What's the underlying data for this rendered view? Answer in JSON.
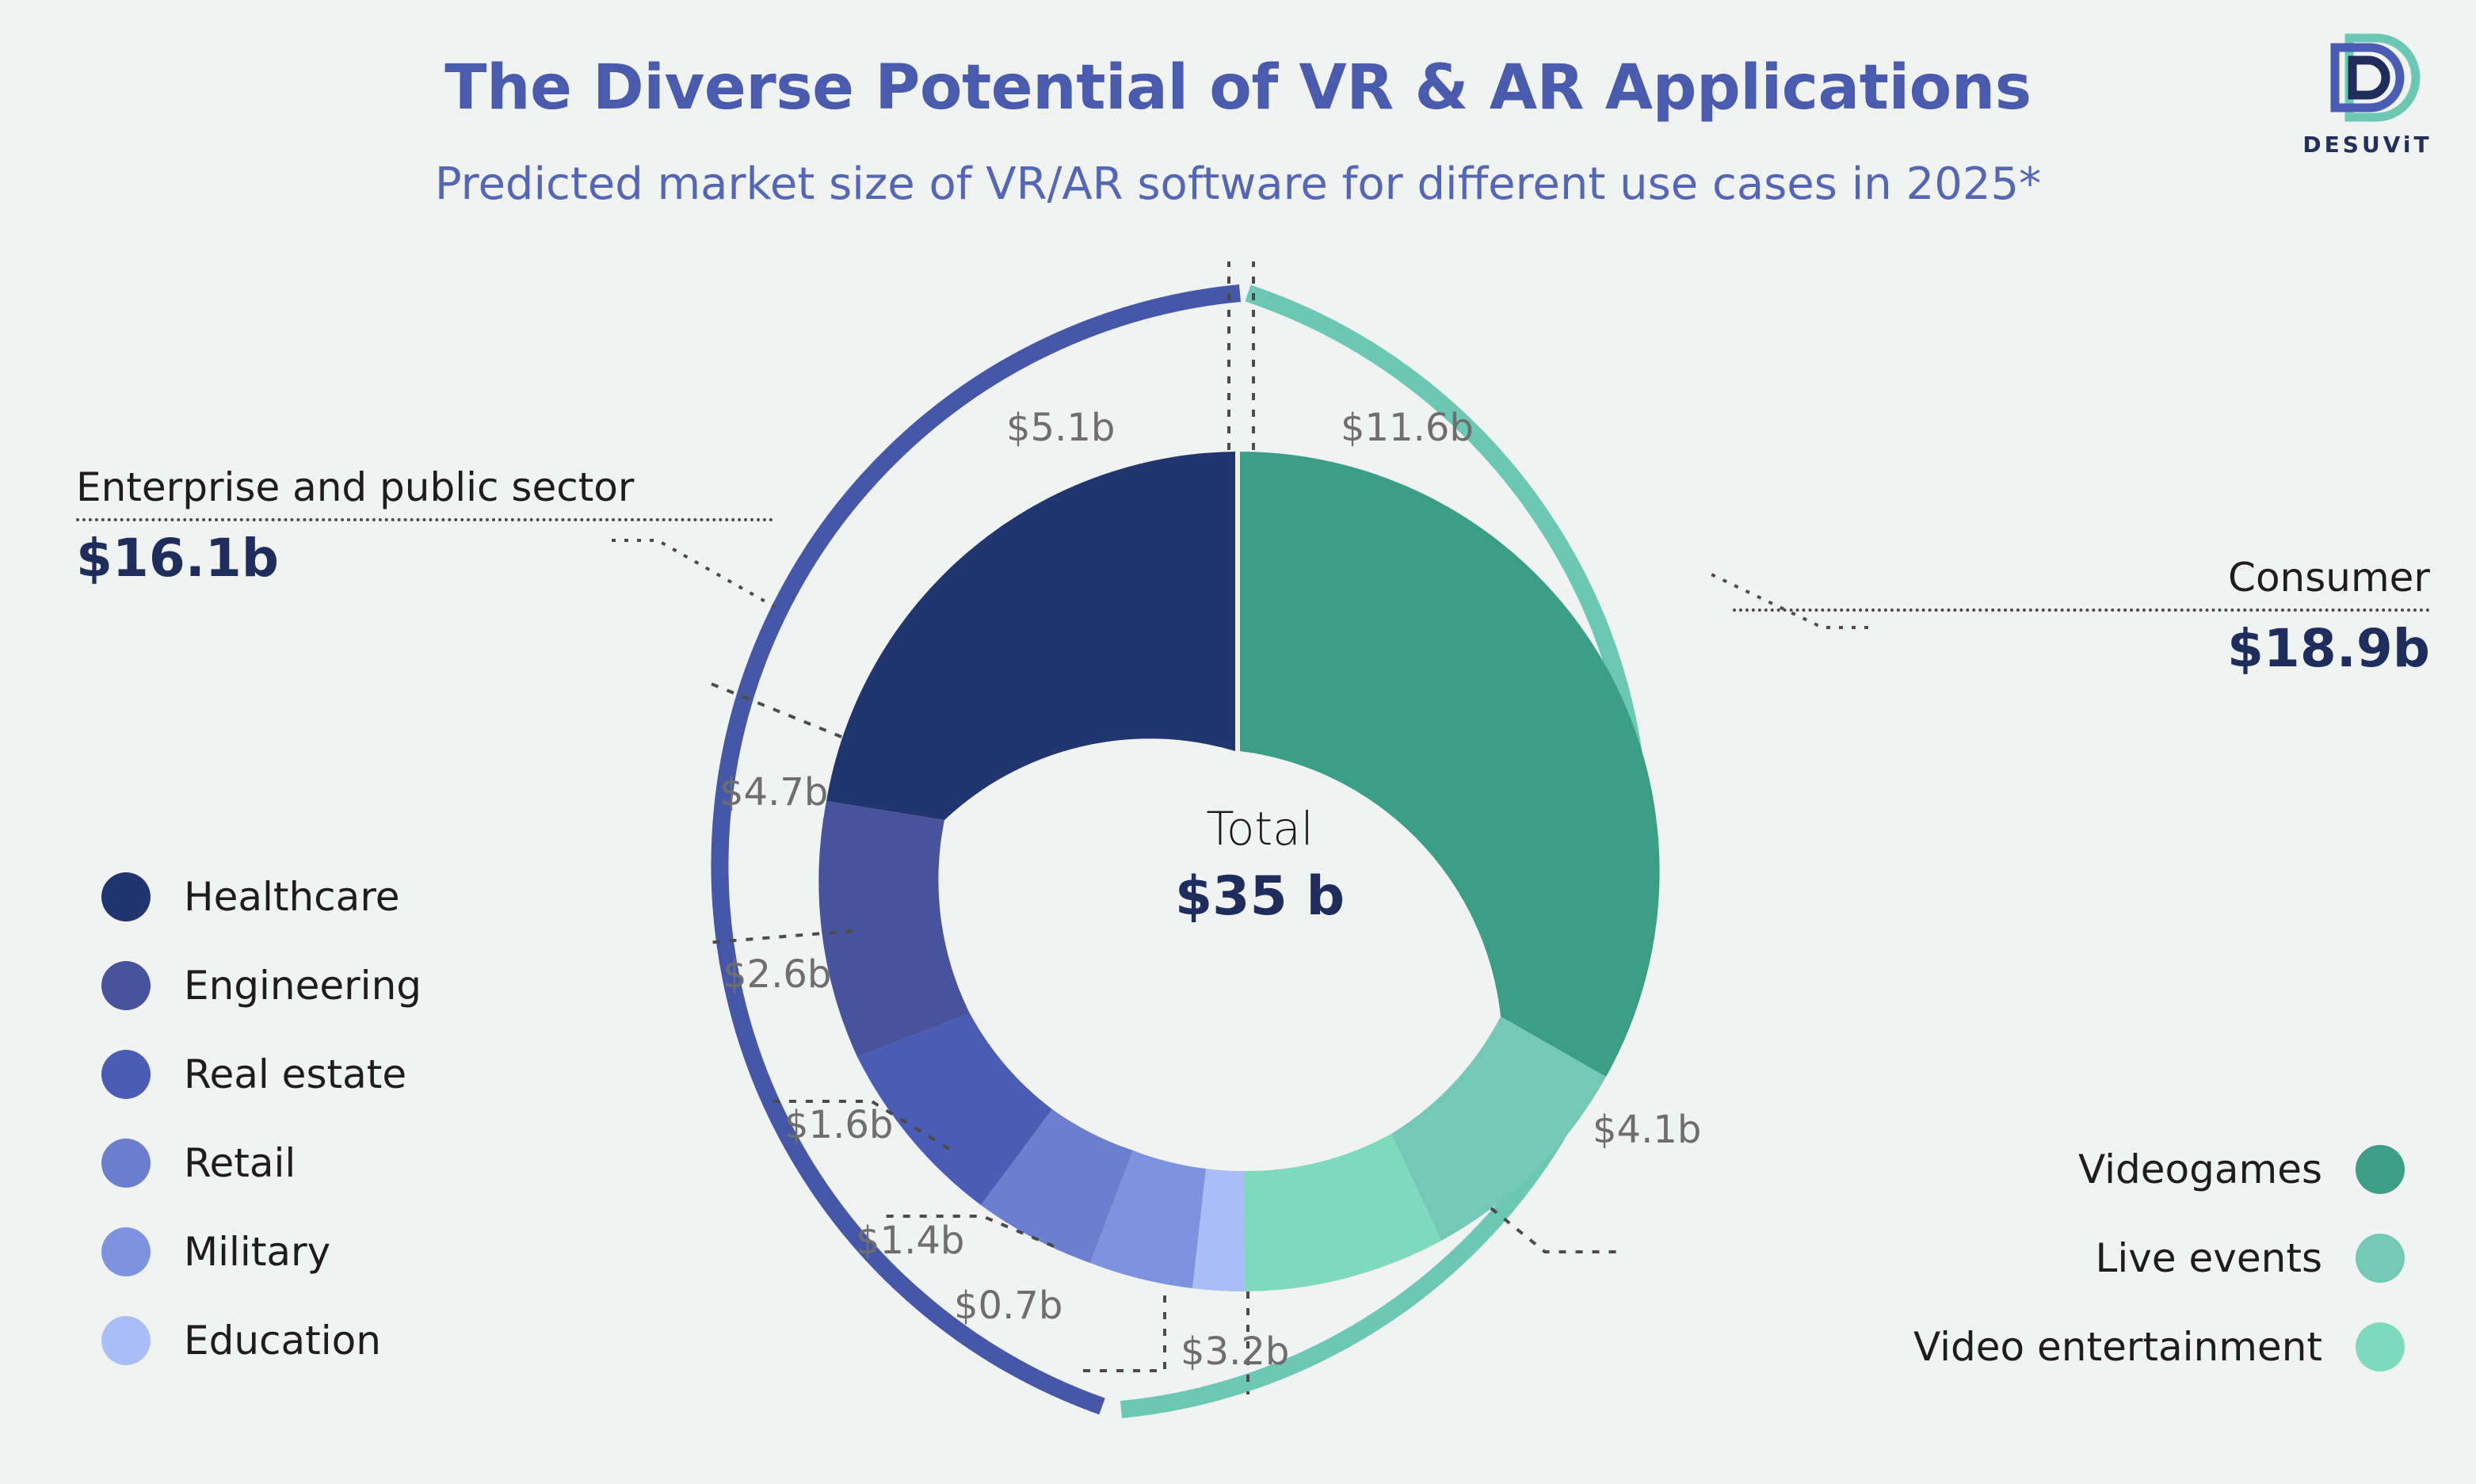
{
  "header": {
    "title": "The Diverse Potential of VR & AR Applications",
    "subtitle": "Predicted market size of VR/AR software for different use cases in 2025*"
  },
  "logo": {
    "wordmark": "DESUViT"
  },
  "center": {
    "label": "Total",
    "value": "$35 b"
  },
  "callouts": {
    "enterprise": {
      "category": "Enterprise and public sector",
      "value": "$16.1b"
    },
    "consumer": {
      "category": "Consumer",
      "value": "$18.9b"
    }
  },
  "segment_labels": {
    "healthcare": "$5.1b",
    "engineering": "$4.7b",
    "real_estate": "$2.6b",
    "retail": "$1.6b",
    "military": "$1.4b",
    "education": "$0.7b",
    "videogames": "$11.6b",
    "live_events": "$4.1b",
    "video_entertainment": "$3.2b"
  },
  "legend_left": {
    "items": [
      {
        "label": "Healthcare",
        "color": "#21356e"
      },
      {
        "label": "Engineering",
        "color": "#47549b"
      },
      {
        "label": "Real estate",
        "color": "#4a5cb4"
      },
      {
        "label": "Retail",
        "color": "#6b7fce"
      },
      {
        "label": "Military",
        "color": "#7d93e0"
      },
      {
        "label": "Education",
        "color": "#aabdf5"
      }
    ]
  },
  "legend_right": {
    "items": [
      {
        "label": "Videogames",
        "color": "#3d9e87"
      },
      {
        "label": "Live events",
        "color": "#74c8b5"
      },
      {
        "label": "Video entertainment",
        "color": "#7fd9bd"
      }
    ]
  },
  "colors": {
    "background": "#f1f3f2",
    "title": "#4a5aac",
    "subtitle": "#5566b5",
    "value_navy": "#1f2d5c",
    "segment_label": "#6e6e6e",
    "outer_enterprise": "#4757a8",
    "outer_consumer": "#6cc8b5",
    "leader": "#4b4b4b"
  },
  "chart_data": {
    "type": "pie",
    "title": "The Diverse Potential of VR & AR Applications",
    "subtitle": "Predicted market size of VR/AR software for different use cases in 2025*",
    "unit": "billion USD",
    "total": 35,
    "total_label": "$35 b",
    "center_label": "Total",
    "legend_position": "left and right",
    "groups": [
      {
        "name": "Enterprise and public sector",
        "value": 16.1,
        "value_label": "$16.1b",
        "color": "#4757a8",
        "side": "left",
        "slices": [
          {
            "name": "Healthcare",
            "value": 5.1,
            "label": "$5.1b",
            "color": "#21356e"
          },
          {
            "name": "Engineering",
            "value": 4.7,
            "label": "$4.7b",
            "color": "#47549b"
          },
          {
            "name": "Real estate",
            "value": 2.6,
            "label": "$2.6b",
            "color": "#4a5cb4"
          },
          {
            "name": "Retail",
            "value": 1.6,
            "label": "$1.6b",
            "color": "#6b7fce"
          },
          {
            "name": "Military",
            "value": 1.4,
            "label": "$1.4b",
            "color": "#7d93e0"
          },
          {
            "name": "Education",
            "value": 0.7,
            "label": "$0.7b",
            "color": "#aabdf5"
          }
        ]
      },
      {
        "name": "Consumer",
        "value": 18.9,
        "value_label": "$18.9b",
        "color": "#6cc8b5",
        "side": "right",
        "slices": [
          {
            "name": "Videogames",
            "value": 11.6,
            "label": "$11.6b",
            "color": "#3d9e87"
          },
          {
            "name": "Live events",
            "value": 4.1,
            "label": "$4.1b",
            "color": "#74c8b5"
          },
          {
            "name": "Video entertainment",
            "value": 3.2,
            "label": "$3.2b",
            "color": "#7fd9bd"
          }
        ]
      }
    ],
    "categories": [
      "Videogames",
      "Live events",
      "Video entertainment",
      "Education",
      "Military",
      "Retail",
      "Real estate",
      "Engineering",
      "Healthcare"
    ],
    "values": [
      11.6,
      4.1,
      3.2,
      0.7,
      1.4,
      1.6,
      2.6,
      4.7,
      5.1
    ],
    "footnote": "*"
  }
}
